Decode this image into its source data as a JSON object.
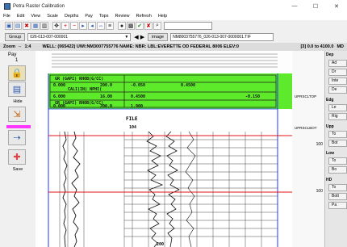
{
  "window": {
    "title": "Petra Raster Calibration",
    "controls": [
      "—",
      "☐",
      "✕"
    ]
  },
  "menu": [
    "File",
    "Edit",
    "View",
    "Scale",
    "Depths",
    "Pay",
    "Tops",
    "Review",
    "Refresh",
    "Help"
  ],
  "group_bar": {
    "group_label": "Group",
    "group_value": "026-013-007-000001",
    "image_label": "image",
    "image_value": "NM8003755776_026-013-007-0000001.TIF"
  },
  "zoom_row": {
    "zoom_label": "Zoom",
    "zoom_value": "1:4",
    "well_text": "WELL: (065422) UWI:NM3007755776 NAME: NBR: LBL:EVERETTE OD FEDERAL 8006 ELEV:0",
    "range_text": "[3] 0.0 to 4100.0",
    "right_text": "MD"
  },
  "left_panel": {
    "title": "Pay",
    "subtitle": "1",
    "hide_label": "Hide",
    "save_label": "Save"
  },
  "log_header": {
    "row1": "GR  (GAPI)        RHOB(G/CC)",
    "row2a": "0.000",
    "row2b": "200.0",
    "row2c": "-0.050",
    "row2d": "0.4500",
    "row3": "CALI(IN)        NPHI(",
    "row4a": "6.000",
    "row4b": "16.00",
    "row4c": "0.4500",
    "row4d": "-0.150",
    "row5": "GR  (GAPI)        RHOB(G/CC)",
    "row6a": "0.000",
    "row6b": "200.0",
    "row6c": "1.900"
  },
  "file_text": "FILE",
  "file_num": "104",
  "bottom_text": "200",
  "right_labels": {
    "top1": "UPRSCLTOP",
    "top2": "UPRSCLBOT",
    "d1": "100",
    "d2": "100"
  },
  "side_panel": {
    "items": [
      "Dep",
      "Ad",
      "Dr",
      "Inte",
      "De",
      "Edg",
      "Le",
      "Rig",
      "Upp",
      "To",
      "Bot",
      "Low",
      "To",
      "Bo",
      "HD",
      "To",
      "Bott",
      "Pa"
    ]
  }
}
